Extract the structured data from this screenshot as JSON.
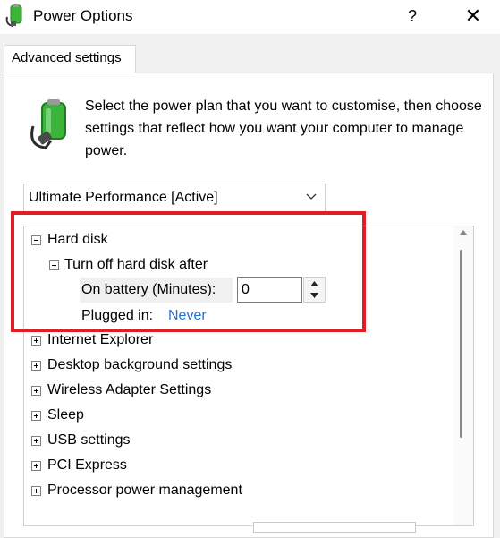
{
  "window": {
    "title": "Power Options",
    "help_label": "?",
    "close_label": "✕"
  },
  "tabs": [
    {
      "label": "Advanced settings"
    }
  ],
  "description": "Select the power plan that you want to customise, then choose settings that reflect how you want your computer to manage power.",
  "plan_dropdown": {
    "selected": "Ultimate Performance [Active]"
  },
  "tree": {
    "hard_disk": {
      "label": "Hard disk",
      "turn_off": {
        "label": "Turn off hard disk after",
        "on_battery_label": "On battery (Minutes):",
        "on_battery_value": "0",
        "plugged_in_label": "Plugged in:",
        "plugged_in_value": "Never"
      }
    },
    "collapsed_items": [
      {
        "label": "Internet Explorer"
      },
      {
        "label": "Desktop background settings"
      },
      {
        "label": "Wireless Adapter Settings"
      },
      {
        "label": "Sleep"
      },
      {
        "label": "USB settings"
      },
      {
        "label": "PCI Express"
      },
      {
        "label": "Processor power management"
      }
    ]
  },
  "colors": {
    "highlight": "#e01e26",
    "link": "#1f6fd6",
    "battery_green": "#3cb43c"
  }
}
